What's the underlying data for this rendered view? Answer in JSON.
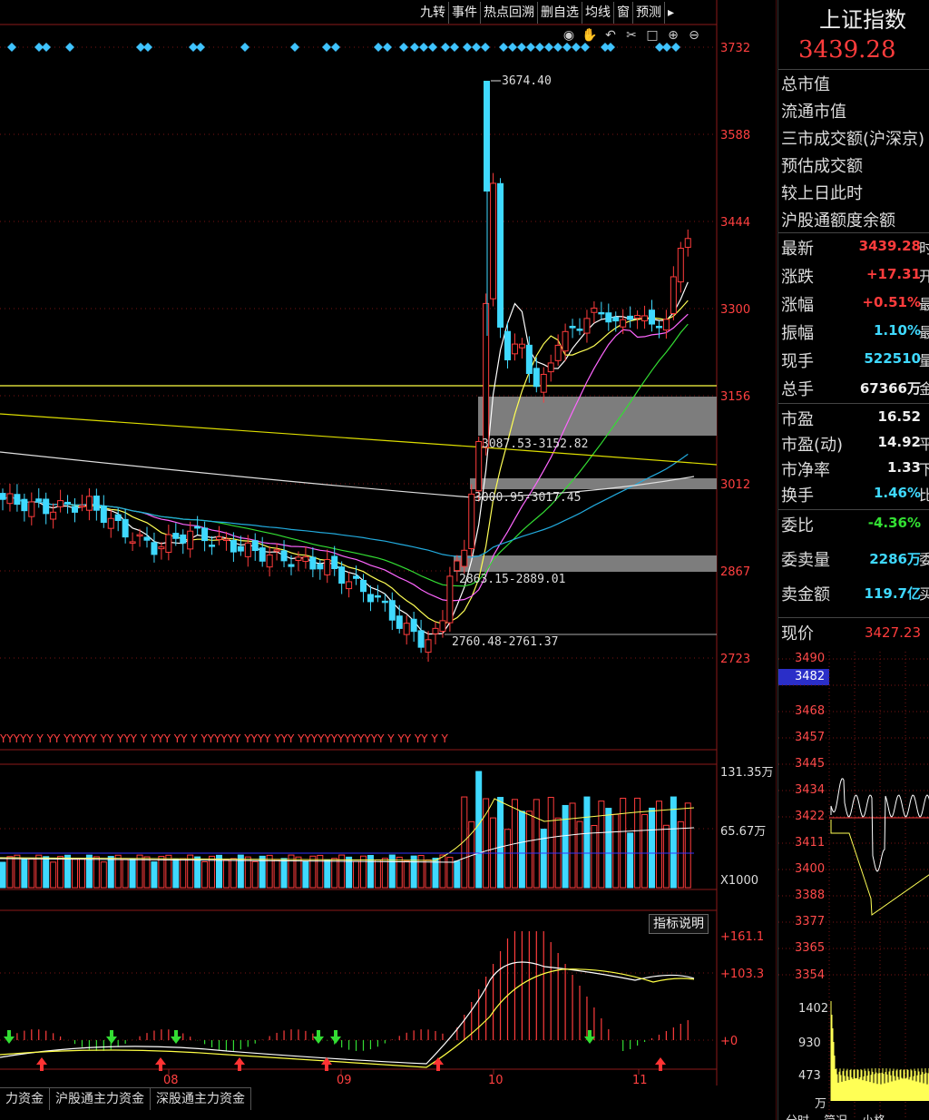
{
  "toolbar": {
    "buttons": [
      "九转",
      "事件",
      "热点回溯",
      "删自选",
      "均线",
      "窗",
      "预测"
    ],
    "icons": [
      "eye-icon",
      "hand-icon",
      "undo-icon",
      "scissors-icon",
      "lock-icon",
      "zoom-in-icon",
      "zoom-out-icon"
    ]
  },
  "price_axis": {
    "ticks": [
      "3732",
      "3588",
      "3444",
      "3300",
      "3156",
      "3012",
      "2867",
      "2723"
    ]
  },
  "annotations": {
    "high_label": "3674.40",
    "gaps": [
      "3087.53-3152.82",
      "3000.95-3017.45",
      "2863.15-2889.01",
      "2760.48-2761.37"
    ]
  },
  "volume_axis": {
    "ticks": [
      "131.35万",
      "65.67万"
    ],
    "unit": "X1000"
  },
  "macd_axis": {
    "ticks": [
      "161.1",
      "103.3",
      "0"
    ]
  },
  "indicator_button": "指标说明",
  "x_axis": {
    "months": [
      "08",
      "09",
      "10",
      "11"
    ]
  },
  "bottom_tabs": [
    "力资金",
    "沪股通主力资金",
    "深股通主力资金"
  ],
  "panel": {
    "name": "上证指数",
    "price": "3439.28",
    "stats_labels": [
      "总市值",
      "流通市值",
      "三市成交额(沪深京)",
      "预估成交额",
      "较上日此时",
      "沪股通额度余额"
    ],
    "quote": [
      {
        "label": "最新",
        "value": "3439.28",
        "color": "#ff3c3c",
        "tail": "时"
      },
      {
        "label": "涨跌",
        "value": "+17.31",
        "color": "#ff3c3c",
        "tail": "开"
      },
      {
        "label": "涨幅",
        "value": "+0.51%",
        "color": "#ff3c3c",
        "tail": "最"
      },
      {
        "label": "振幅",
        "value": "1.10%",
        "color": "#3fd9ff",
        "tail": "最"
      },
      {
        "label": "现手",
        "value": "522510",
        "color": "#3fd9ff",
        "tail": "量"
      },
      {
        "label": "总手",
        "value": "67366万",
        "color": "#eeeeee",
        "tail": "金"
      },
      {
        "label": "市盈",
        "value": "16.52",
        "color": "#eeeeee",
        "tail": ""
      },
      {
        "label": "市盈(动)",
        "value": "14.92",
        "color": "#eeeeee",
        "tail": "平"
      },
      {
        "label": "市净率",
        "value": "1.33",
        "color": "#eeeeee",
        "tail": "下"
      },
      {
        "label": "换手",
        "value": "1.46%",
        "color": "#3fd9ff",
        "tail": "比"
      },
      {
        "label": "委比",
        "value": "-4.36%",
        "color": "#33e033",
        "tail": ""
      },
      {
        "label": "委卖量",
        "value": "2286万",
        "color": "#3fd9ff",
        "tail": "委"
      },
      {
        "label": "卖金额",
        "value": "119.7亿",
        "color": "#3fd9ff",
        "tail": "买"
      }
    ],
    "current_label": "现价",
    "current_value": "3427.23",
    "mini_ticks": [
      "3490",
      "3482",
      "3468",
      "3457",
      "3445",
      "3434",
      "3422",
      "3411",
      "3400",
      "3388",
      "3377",
      "3365",
      "3354"
    ],
    "mini_vol_ticks": [
      "1402",
      "930",
      "473",
      "万"
    ],
    "mini_tabs": [
      "分时",
      "简况",
      "小格"
    ]
  },
  "colors": {
    "up": "#ff3c3c",
    "down": "#3fd9ff",
    "ma5": "#ffffff",
    "ma10": "#ffff55",
    "ma20": "#ff66ff",
    "ma30": "#33dd33",
    "ma60": "#22aadd",
    "ma120": "#e0e0e0",
    "ma250": "#dddd00"
  }
}
